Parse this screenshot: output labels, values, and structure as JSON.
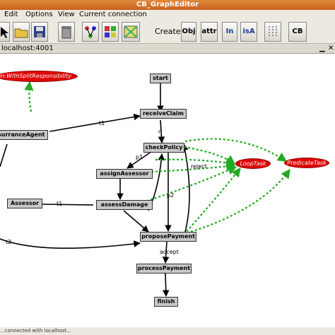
{
  "window": {
    "title": "CB_GraphEditor"
  },
  "menu": [
    "Edit",
    "Options",
    "View",
    "Current connection"
  ],
  "toolbar": {
    "create_label": "Create",
    "obj": "Obj",
    "attr": "attr",
    "in": "In",
    "isa": "isA",
    "cb": "CB"
  },
  "tab": {
    "label": "localhost:4001"
  },
  "graph": {
    "start": "start",
    "receiveClaim": "receiveClaim",
    "checkPolicy": "checkPolicy",
    "assignAssessor": "assignAssessor",
    "assessDamage": "assessDamage",
    "proposePayment": "proposePayment",
    "processPayment": "processPayment",
    "finish": "finish",
    "insuranceAgent": "surranceAgent",
    "assessor": "Assessor",
    "splitResp": "en:WithSplitResponsibility",
    "loopTask": "LoopTask",
    "predicateTask": "PredicateTask"
  },
  "edge_labels": {
    "t1a": "t1",
    "t1b": "t1",
    "t2": "t2",
    "n": "n",
    "p1": "p1",
    "p2": "p2",
    "reject": "reject",
    "accept": "accept"
  },
  "status": {
    "text": "...connected with localhost..."
  },
  "colors": {
    "node": "#c9c9c9",
    "ellipse": "#dd0000",
    "green_edge": "#22aa22",
    "title": "#d7742c"
  }
}
